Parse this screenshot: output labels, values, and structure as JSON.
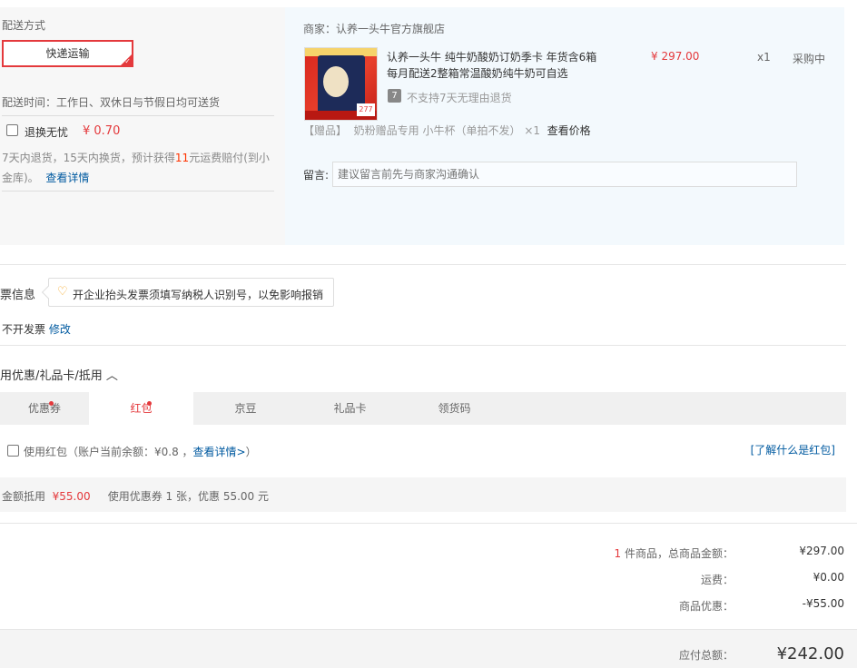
{
  "delivery": {
    "title": "配送方式",
    "method": "快递运输",
    "time_text": "配送时间：工作日、双休日与节假日均可送货",
    "return_label": "退换无忧",
    "return_price": "¥ 0.70",
    "return_desc_1": "7天内退货，15天内换货，预计获得",
    "return_desc_num": "11",
    "return_desc_2": "元运费赔付(到小",
    "return_desc_3": "金库)。",
    "return_link": "查看详情"
  },
  "order": {
    "merchant": "商家：认养一头牛官方旗舰店",
    "product_title_1": "认养一头牛 纯牛奶酸奶订奶季卡 年货含6箱",
    "product_title_2": "每月配送2整箱常温酸奶纯牛奶可自选",
    "price": "¥ 297.00",
    "qty": "x1",
    "status": "采购中",
    "badge_7": "7",
    "no_return": "不支持7天无理由退货",
    "gift_tag": "【赠品】",
    "gift_name": "奶粉赠品专用 小牛杯（单拍不发）",
    "gift_qty": "×1",
    "gift_link": "查看价格",
    "note_label": "留言:",
    "note_placeholder": "建议留言前先与商家沟通确认",
    "img_price_tag": "277"
  },
  "invoice": {
    "title": "票信息",
    "tip": "开企业抬头发票须填写纳税人识别号，以免影响报销",
    "value": "不开发票",
    "edit": "修改"
  },
  "discount": {
    "title": "用优惠/礼品卡/抵用",
    "tabs": [
      "优惠券",
      "红包",
      "京豆",
      "礼品卡",
      "领货码"
    ],
    "redpacket_label": "使用红包（账户当前余额：¥0.8 ，",
    "redpacket_link": "查看详情>",
    "redpacket_close": "）",
    "what_link": "[了解什么是红包]",
    "summary_label": "金额抵用",
    "summary_amount": "¥55.00",
    "summary_text": "使用优惠券 1 张，优惠 55.00 元"
  },
  "totals": {
    "count": "1",
    "count_label": "件商品，总商品金额：",
    "goods_total": "¥297.00",
    "shipping_label": "运费：",
    "shipping": "¥0.00",
    "discount_label": "商品优惠：",
    "discount": "-¥55.00",
    "pay_label": "应付总额：",
    "pay_total": "¥242.00"
  },
  "colors": {
    "accent": "#e4393c",
    "link": "#005aa0",
    "panel_blue": "#f3f9fd",
    "panel_gray": "#f7f7f7"
  }
}
